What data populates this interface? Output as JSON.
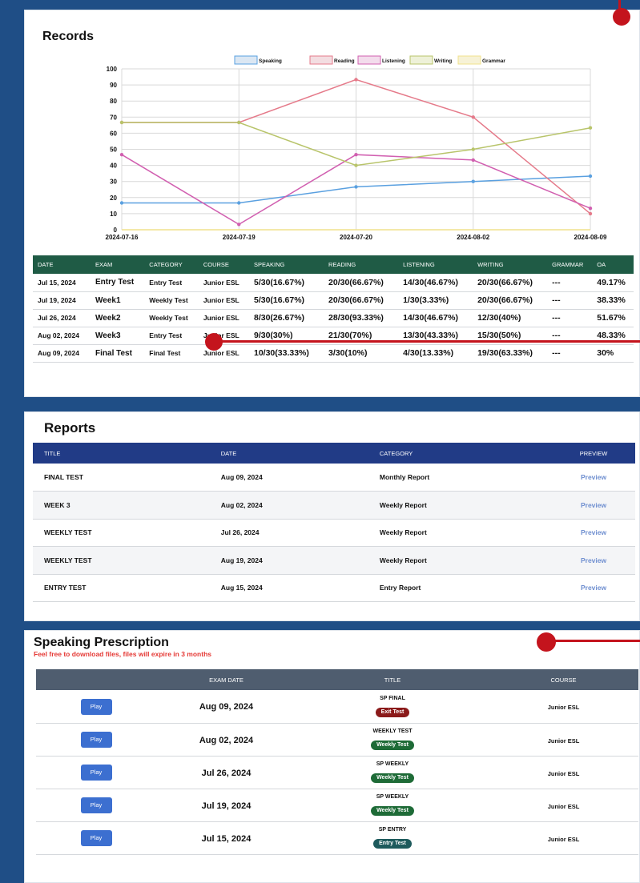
{
  "records": {
    "title": "Records",
    "columns": [
      "DATE",
      "EXAM",
      "CATEGORY",
      "COURSE",
      "SPEAKING",
      "READING",
      "LISTENING",
      "WRITING",
      "GRAMMAR",
      "OA"
    ],
    "rows": [
      [
        "Jul 15, 2024",
        "Entry Test",
        "Entry Test",
        "Junior ESL",
        "5/30(16.67%)",
        "20/30(66.67%)",
        "14/30(46.67%)",
        "20/30(66.67%)",
        "---",
        "49.17%"
      ],
      [
        "Jul 19, 2024",
        "Week1",
        "Weekly Test",
        "Junior ESL",
        "5/30(16.67%)",
        "20/30(66.67%)",
        "1/30(3.33%)",
        "20/30(66.67%)",
        "---",
        "38.33%"
      ],
      [
        "Jul 26, 2024",
        "Week2",
        "Weekly Test",
        "Junior ESL",
        "8/30(26.67%)",
        "28/30(93.33%)",
        "14/30(46.67%)",
        "12/30(40%)",
        "---",
        "51.67%"
      ],
      [
        "Aug 02, 2024",
        "Week3",
        "Entry Test",
        "Junior ESL",
        "9/30(30%)",
        "21/30(70%)",
        "13/30(43.33%)",
        "15/30(50%)",
        "---",
        "48.33%"
      ],
      [
        "Aug 09, 2024",
        "Final Test",
        "Final Test",
        "Junior ESL",
        "10/30(33.33%)",
        "3/30(10%)",
        "4/30(13.33%)",
        "19/30(63.33%)",
        "---",
        "30%"
      ]
    ]
  },
  "reports": {
    "title": "Reports",
    "columns": [
      "TITLE",
      "DATE",
      "CATEGORY",
      "PREVIEW"
    ],
    "rows": [
      [
        "FINAL TEST",
        "Aug 09, 2024",
        "Monthly Report",
        "Preview"
      ],
      [
        "WEEK 3",
        "Aug 02, 2024",
        "Weekly Report",
        "Preview"
      ],
      [
        "WEEKLY TEST",
        "Jul 26, 2024",
        "Weekly Report",
        "Preview"
      ],
      [
        "WEEKLY TEST",
        "Aug 19, 2024",
        "Weekly Report",
        "Preview"
      ],
      [
        "ENTRY TEST",
        "Aug 15, 2024",
        "Entry Report",
        "Preview"
      ]
    ]
  },
  "prescription": {
    "title": "Speaking Prescription",
    "subtitle": "Feel free to download files, files will expire in 3 months",
    "columns": [
      "",
      "EXAM DATE",
      "TITLE",
      "COURSE"
    ],
    "play_label": "Play",
    "rows": [
      {
        "date": "Aug 09, 2024",
        "title": "SP FINAL",
        "badge": "Exit Test",
        "badge_color": "#8b1a1a",
        "course": "Junior ESL"
      },
      {
        "date": "Aug 02, 2024",
        "title": "WEEKLY TEST",
        "badge": "Weekly Test",
        "badge_color": "#1e6b37",
        "course": "Junior ESL"
      },
      {
        "date": "Jul 26, 2024",
        "title": "SP WEEKLY",
        "badge": "Weekly Test",
        "badge_color": "#1e6b37",
        "course": "Junior ESL"
      },
      {
        "date": "Jul 19, 2024",
        "title": "SP WEEKLY",
        "badge": "Weekly Test",
        "badge_color": "#1e6b37",
        "course": "Junior ESL"
      },
      {
        "date": "Jul 15, 2024",
        "title": "SP ENTRY",
        "badge": "Entry Test",
        "badge_color": "#1d5a5c",
        "course": "Junior ESL"
      }
    ]
  },
  "colors": {
    "background": "#1f4e86",
    "records_header": "#1f5b45",
    "reports_header": "#213b86",
    "prescription_header": "#4f5d6f",
    "marker": "#c4141d"
  },
  "chart_data": {
    "type": "line",
    "x": [
      "2024-07-16",
      "2024-07-19",
      "2024-07-20",
      "2024-08-02",
      "2024-08-09"
    ],
    "ylim": [
      0,
      100
    ],
    "yticks": [
      0,
      10,
      20,
      30,
      40,
      50,
      60,
      70,
      80,
      90,
      100
    ],
    "grid": true,
    "legend": "top-center",
    "series": [
      {
        "name": "Speaking",
        "color": "#5aa0e0",
        "fill": "#dbe7f3",
        "values": [
          16.67,
          16.67,
          26.67,
          30,
          33.33
        ]
      },
      {
        "name": "Reading",
        "color": "#e57a8a",
        "fill": "#f3dde1",
        "values": [
          66.67,
          66.67,
          93.33,
          70,
          10
        ]
      },
      {
        "name": "Listening",
        "color": "#d15fb0",
        "fill": "#f3dcec",
        "values": [
          46.67,
          3.33,
          46.67,
          43.33,
          13.33
        ]
      },
      {
        "name": "Writing",
        "color": "#b8c46a",
        "fill": "#eef1d8",
        "values": [
          66.67,
          66.67,
          40,
          50,
          63.33
        ]
      },
      {
        "name": "Grammar",
        "color": "#f0e28c",
        "fill": "#f7f2d6",
        "values": [
          null,
          null,
          null,
          null,
          null
        ]
      }
    ]
  }
}
